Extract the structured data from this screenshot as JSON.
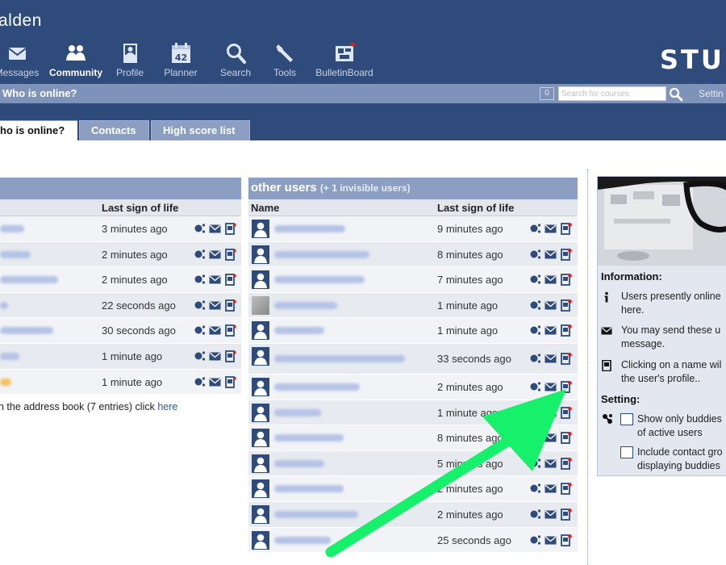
{
  "header": {
    "title": "alden",
    "logo_text": "STU",
    "nav": [
      {
        "label": "Messages",
        "icon": "envelope-icon",
        "active": false
      },
      {
        "label": "Community",
        "icon": "community-icon",
        "active": true
      },
      {
        "label": "Profile",
        "icon": "profile-icon",
        "active": false
      },
      {
        "label": "Planner",
        "icon": "calendar-icon",
        "badge": "42",
        "active": false
      },
      {
        "label": "Search",
        "icon": "search-icon",
        "active": false
      },
      {
        "label": "Tools",
        "icon": "wrench-icon",
        "active": false
      },
      {
        "label": "BulletinBoard",
        "icon": "bulletin-icon",
        "active": false
      }
    ]
  },
  "subbar": {
    "title": "Who is online?",
    "course_count": "0",
    "search_placeholder": "Search for courses",
    "settings_label": "Settin"
  },
  "tabs": [
    {
      "label": "ho is online?",
      "active": true
    },
    {
      "label": "Contacts",
      "active": false
    },
    {
      "label": "High score list",
      "active": false
    }
  ],
  "buddies_table": {
    "col_last": "Last sign of life",
    "rows": [
      {
        "time": "3 minutes ago"
      },
      {
        "time": "2 minutes ago"
      },
      {
        "time": "2 minutes ago"
      },
      {
        "time": "22 seconds ago"
      },
      {
        "time": "30 seconds ago"
      },
      {
        "time": "1 minute ago"
      },
      {
        "time": "1 minute ago"
      }
    ],
    "address_book_note": "n the address book (7 entries) click ",
    "address_book_link": "here"
  },
  "other_users": {
    "title": "other users",
    "invisible_note": "(+ 1 invisible users)",
    "col_name": "Name",
    "col_last": "Last sign of life",
    "rows": [
      {
        "time": "9 minutes ago"
      },
      {
        "time": "8 minutes ago"
      },
      {
        "time": "7 minutes ago"
      },
      {
        "time": "1 minute ago"
      },
      {
        "time": "1 minute ago"
      },
      {
        "time": "33 seconds ago"
      },
      {
        "time": "2 minutes ago"
      },
      {
        "time": "1 minute ago"
      },
      {
        "time": "8 minutes ago"
      },
      {
        "time": "5 minutes ago"
      },
      {
        "time": "2 minutes ago"
      },
      {
        "time": "2 minutes ago"
      },
      {
        "time": "25 seconds ago"
      }
    ]
  },
  "info_panel": {
    "information_heading": "Information:",
    "items": [
      {
        "icon": "info-icon",
        "text": "Users presently online\nhere."
      },
      {
        "icon": "envelope-icon",
        "text": "You may send these u\nmessage."
      },
      {
        "icon": "profile-icon",
        "text": "Clicking on a name wil\nthe user's profile.."
      }
    ],
    "setting_heading": "Setting:",
    "settings": [
      {
        "label": "Show only buddies\nof active users",
        "checked": false
      },
      {
        "label": "Include contact gro\ndisplaying buddies",
        "checked": false
      }
    ]
  },
  "colors": {
    "header_bg": "#2f4b7c",
    "subbar_bg": "#7f93b9",
    "table_head_bg": "#8c9ec2",
    "icon_blue": "#2f4b7c",
    "annotation_arrow": "#16f06a"
  }
}
